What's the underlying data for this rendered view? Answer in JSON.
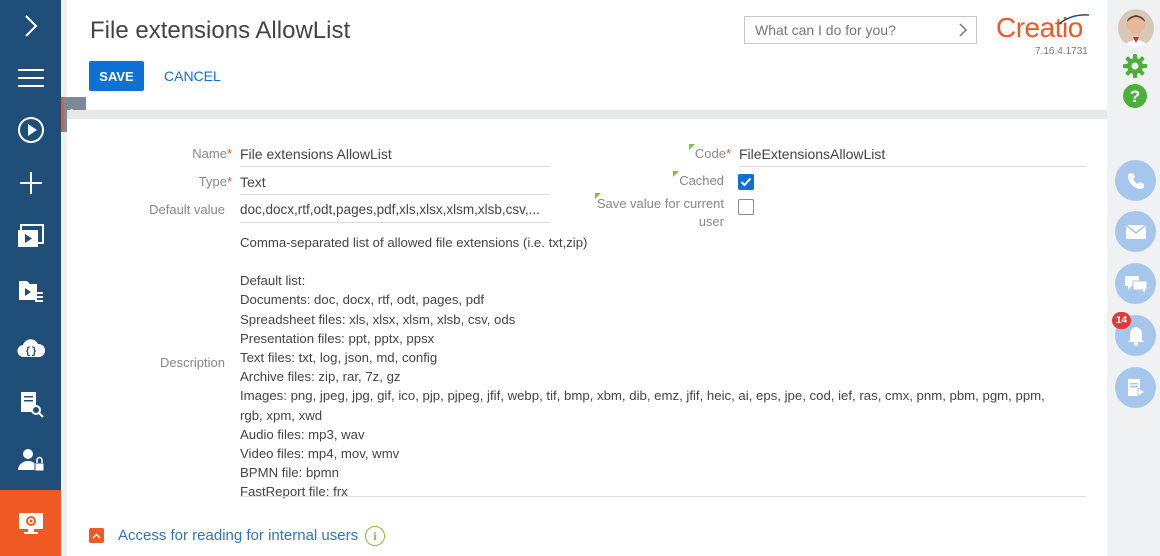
{
  "header": {
    "title": "File extensions AllowList",
    "save_label": "SAVE",
    "cancel_label": "CANCEL",
    "search_placeholder": "What can I do for you?",
    "logo_text": "Creatio",
    "version": "7.16.4.1731"
  },
  "form": {
    "name_label": "Name",
    "name_value": "File extensions AllowList",
    "type_label": "Type",
    "type_value": "Text",
    "default_value_label": "Default value",
    "default_value": "doc,docx,rtf,odt,pages,pdf,xls,xlsx,xlsm,xlsb,csv,...",
    "code_label": "Code",
    "code_value": "FileExtensionsAllowList",
    "cached_label": "Cached",
    "cached_checked": true,
    "save_value_label_line1": "Save value for current",
    "save_value_label_line2": "user",
    "save_value_checked": false,
    "required_mark": "*",
    "description_label": "Description",
    "description_lines": [
      "Comma-separated list of allowed file extensions (i.e. txt,zip)",
      "",
      "Default list:",
      "Documents: doc, docx, rtf, odt, pages, pdf",
      "Spreadsheet files: xls, xlsx, xlsm, xlsb, csv, ods",
      "Presentation files: ppt, pptx, ppsx",
      "Text files: txt, log, json, md, config",
      "Archive files: zip, rar, 7z, gz",
      "Images: png, jpeg, jpg, gif, ico, pjp, pjpeg, jfif, webp, tif, bmp, xbm, dib, emz, jfif, heic, ai, eps, jpe, cod, ief, ras, cmx, pnm, pbm, pgm, ppm,",
      "rgb, xpm, xwd",
      "Audio files: mp3, wav",
      "Video files: mp4, mov, wmv",
      "BPMN file: bpmn",
      "FastReport file: frx"
    ],
    "access_label": "Access for reading for internal users",
    "info_symbol": "i"
  },
  "notifications": {
    "count": "14"
  },
  "colors": {
    "nav_bg": "#1f4e79",
    "accent": "#ef5a24",
    "primary": "#0d72d4",
    "green": "#7dc142"
  }
}
